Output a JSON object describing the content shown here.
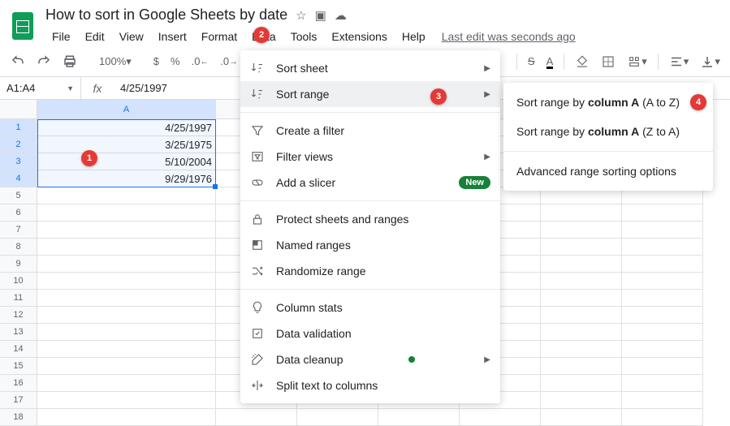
{
  "doc": {
    "title": "How to sort in Google Sheets by date"
  },
  "menubar": [
    "File",
    "Edit",
    "View",
    "Insert",
    "Format",
    "Data",
    "Tools",
    "Extensions",
    "Help"
  ],
  "last_edit": "Last edit was seconds ago",
  "toolbar": {
    "zoom": "100%",
    "currency": "$",
    "percent": "%",
    "decimal_dec": ".0",
    "decimal_inc": ".0"
  },
  "namebox": "A1:A4",
  "formula": "4/25/1997",
  "columns": [
    "A"
  ],
  "rows": [
    {
      "n": 1,
      "a": "4/25/1997"
    },
    {
      "n": 2,
      "a": "3/25/1975"
    },
    {
      "n": 3,
      "a": "5/10/2004"
    },
    {
      "n": 4,
      "a": "9/29/1976"
    }
  ],
  "empty_rows": [
    5,
    6,
    7,
    8,
    9,
    10,
    11,
    12,
    13,
    14,
    15,
    16,
    17,
    18
  ],
  "menu": {
    "sort_sheet": "Sort sheet",
    "sort_range": "Sort range",
    "create_filter": "Create a filter",
    "filter_views": "Filter views",
    "add_slicer": "Add a slicer",
    "new_badge": "New",
    "protect": "Protect sheets and ranges",
    "named_ranges": "Named ranges",
    "randomize": "Randomize range",
    "col_stats": "Column stats",
    "validation": "Data validation",
    "cleanup": "Data cleanup",
    "split": "Split text to columns"
  },
  "submenu": {
    "az_prefix": "Sort range by ",
    "az_bold": "column A",
    "az_suffix": " (A to Z)",
    "za_prefix": "Sort range by ",
    "za_bold": "column A",
    "za_suffix": " (Z to A)",
    "advanced": "Advanced range sorting options"
  },
  "callouts": {
    "c1": "1",
    "c2": "2",
    "c3": "3",
    "c4": "4"
  }
}
